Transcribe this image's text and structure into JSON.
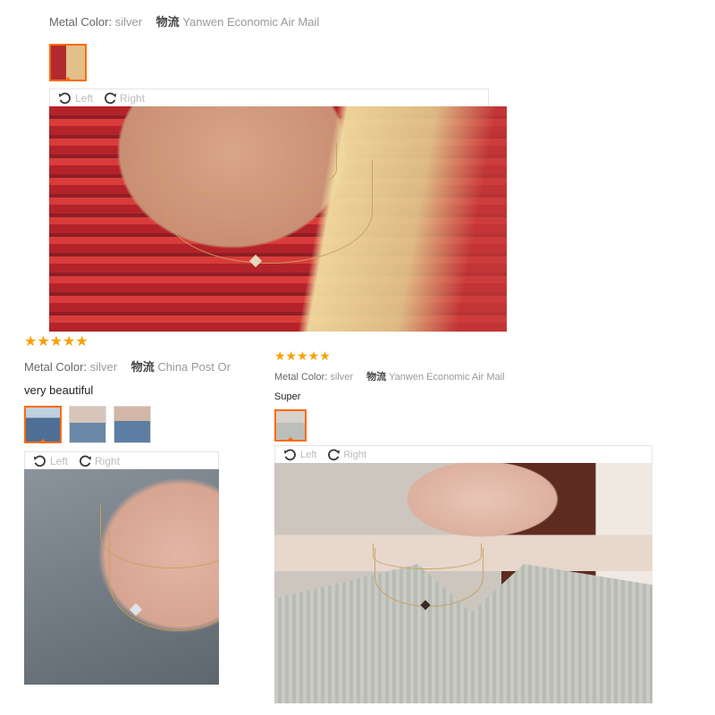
{
  "reviews": [
    {
      "stars": "★★★★★",
      "metal_label": "Metal Color:",
      "metal_value": "silver",
      "ship_label": "物流",
      "ship_value": "Yanwen Economic Air Mail",
      "comment": "",
      "toolbar": {
        "left": "Left",
        "right": "Right"
      }
    },
    {
      "stars": "★★★★★",
      "metal_label": "Metal Color:",
      "metal_value": "silver",
      "ship_label": "物流",
      "ship_value": "China Post Or",
      "comment": "very beautiful",
      "toolbar": {
        "left": "Left",
        "right": "Right"
      }
    },
    {
      "stars": "★★★★★",
      "metal_label": "Metal Color:",
      "metal_value": "silver",
      "ship_label": "物流",
      "ship_value": "Yanwen Economic Air Mail",
      "comment": "Super",
      "toolbar": {
        "left": "Left",
        "right": "Right"
      }
    }
  ],
  "colors": {
    "star": "#f7a000",
    "active_thumb": "#ff6a00"
  },
  "icons": {
    "rotate_left": "rotate-left-icon",
    "rotate_right": "rotate-right-icon"
  }
}
